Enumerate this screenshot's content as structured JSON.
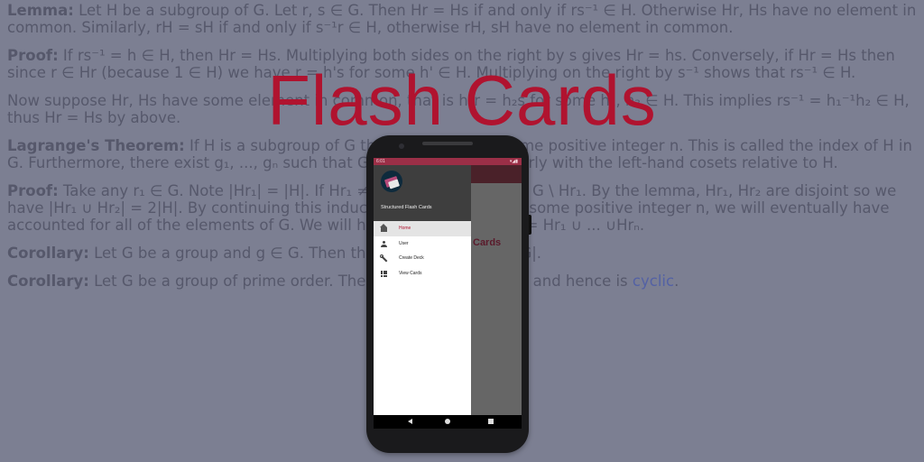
{
  "background_text": {
    "p1_label": "Lemma:",
    "p1": " Let H be a subgroup of G. Let r, s ∈ G. Then Hr = Hs if and only if rs⁻¹ ∈ H. Otherwise Hr, Hs have no element in common. Similarly, rH = sH if and only if s⁻¹r ∈ H, otherwise rH, sH have no element in common.",
    "p2_label": "Proof:",
    "p2": " If rs⁻¹ = h ∈ H, then Hr = Hs. Multiplying both sides on the right by s gives Hr = hs. Conversely, if Hr = Hs then since r ∈ Hr (because 1 ∈ H) we have r = h's for some h' ∈ H. Multiplying on the right by s⁻¹ shows that rs⁻¹ ∈ H.",
    "p3": "Now suppose Hr, Hs have some element in common, that is h₁r = h₂s for some h₁, h₂ ∈ H. This implies rs⁻¹ = h₁⁻¹h₂ ∈ H, thus Hr = Hs by above.",
    "p4_label": "Lagrange's Theorem:",
    "p4": " If H is a subgroup of G then |G| = n|H| for some positive integer n. This is called the index of H in G. Furthermore, there exist g₁, ..., gₙ such that G = Hr₁∪...∪Hrₙ. Similarly with the left-hand cosets relative to H.",
    "p5_label": "Proof:",
    "p5": " Take any r₁ ∈ G. Note |Hr₁| = |H|. If Hr₁ ≠ G then take any r₂ ∈ G \\ Hr₁. By the lemma, Hr₁, Hr₂ are disjoint so we have |Hr₁ ∪ Hr₂| = 2|H|. By continuing this induction, after n steps for some positive integer n, we will eventually have accounted for all of the elements of G. We will have |G| = n|H| and G = Hr₁ ∪ ... ∪Hrₙ.",
    "p6_label": "Corollary:",
    "p6": " Let G be a group and g ∈ G. Then the order of g divides |G|.",
    "p7_label": "Corollary:",
    "p7a": " Let G be a group of prime order. Then G has no subgroups and hence is ",
    "p7_link": "cyclic",
    "p7b": "."
  },
  "title": "Flash Cards",
  "phone": {
    "status_time": "6:01",
    "status_icons": "▾◢▮",
    "main_text": "Cards",
    "drawer": {
      "app_name": "Structured Flash Cards",
      "items": [
        {
          "label": "Home",
          "icon": "home-icon",
          "active": true
        },
        {
          "label": "User",
          "icon": "user-icon",
          "active": false
        },
        {
          "label": "Create Deck",
          "icon": "wrench-icon",
          "active": false
        },
        {
          "label": "View Cards",
          "icon": "grid-icon",
          "active": false
        }
      ]
    }
  },
  "colors": {
    "title": "#b0132f",
    "status_bar": "#9b2f47",
    "drawer_header": "#3e3e3e",
    "active_item": "#b0132f"
  }
}
